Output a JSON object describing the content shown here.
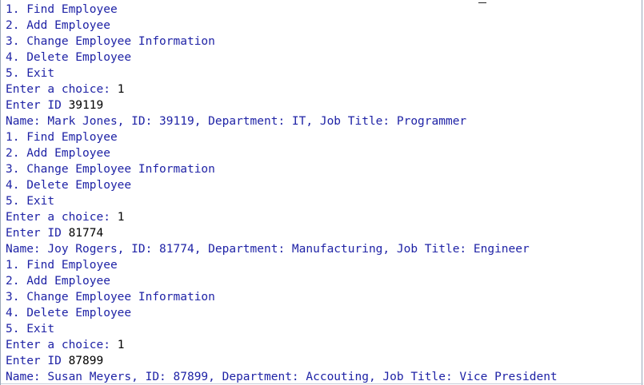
{
  "console": {
    "lines": [
      {
        "text": "1. Find Employee",
        "type": "out"
      },
      {
        "text": "2. Add Employee",
        "type": "out"
      },
      {
        "text": "3. Change Employee Information",
        "type": "out"
      },
      {
        "text": "4. Delete Employee",
        "type": "out"
      },
      {
        "text": "5. Exit",
        "type": "out"
      },
      {
        "text": "Enter a choice: ",
        "input": "1",
        "type": "mixed"
      },
      {
        "text": "Enter ID ",
        "input": "39119",
        "type": "mixed"
      },
      {
        "text": "Name: Mark Jones, ID: 39119, Department: IT, Job Title: Programmer",
        "type": "out"
      },
      {
        "text": "1. Find Employee",
        "type": "out"
      },
      {
        "text": "2. Add Employee",
        "type": "out"
      },
      {
        "text": "3. Change Employee Information",
        "type": "out"
      },
      {
        "text": "4. Delete Employee",
        "type": "out"
      },
      {
        "text": "5. Exit",
        "type": "out"
      },
      {
        "text": "Enter a choice: ",
        "input": "1",
        "type": "mixed"
      },
      {
        "text": "Enter ID ",
        "input": "81774",
        "type": "mixed"
      },
      {
        "text": "Name: Joy Rogers, ID: 81774, Department: Manufacturing, Job Title: Engineer",
        "type": "out"
      },
      {
        "text": "1. Find Employee",
        "type": "out"
      },
      {
        "text": "2. Add Employee",
        "type": "out"
      },
      {
        "text": "3. Change Employee Information",
        "type": "out"
      },
      {
        "text": "4. Delete Employee",
        "type": "out"
      },
      {
        "text": "5. Exit",
        "type": "out"
      },
      {
        "text": "Enter a choice: ",
        "input": "1",
        "type": "mixed"
      },
      {
        "text": "Enter ID ",
        "input": "87899",
        "type": "mixed"
      },
      {
        "text": "Name: Susan Meyers, ID: 87899, Department: Accouting, Job Title: Vice President",
        "type": "out"
      }
    ]
  },
  "colors": {
    "output": "#1f23a6",
    "input": "#000000",
    "background": "#ffffff"
  }
}
